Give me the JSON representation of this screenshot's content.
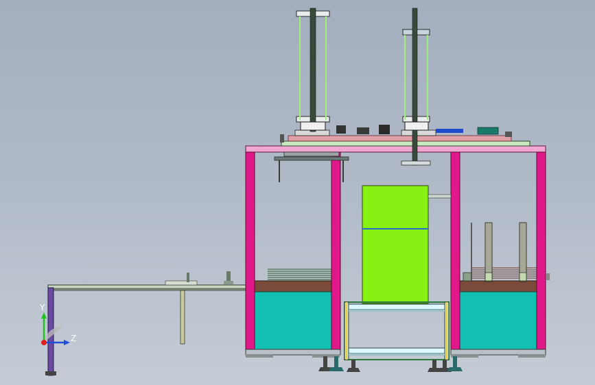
{
  "view": {
    "background_top": "#a3aebe",
    "background_bottom": "#c5ccd6"
  },
  "triad": {
    "y_label": "Y",
    "z_label": "Z",
    "y_color": "#20c020",
    "z_color": "#1f4fd6",
    "x_color": "#e02020"
  },
  "colors": {
    "frame_pillar": "#e0188a",
    "frame_beam": "#f2a6d2",
    "cabinet": "#14bfb4",
    "cabinet_top": "#7a4a3a",
    "tower": "#88f012",
    "conveyor_frame": "#2a7a40",
    "deck_plate": "#c8e8c0",
    "rod_outline": "#9ef07a",
    "lead_screw": "#3a4a3a"
  }
}
